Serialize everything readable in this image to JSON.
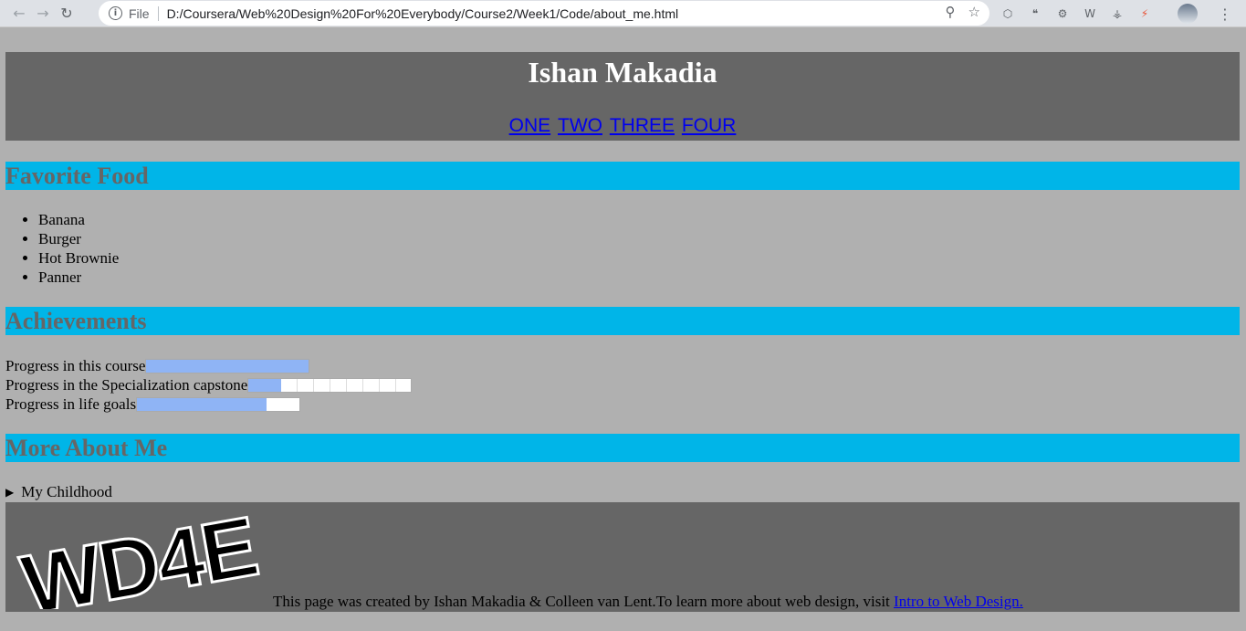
{
  "browser": {
    "url_scheme": "File",
    "url": "D:/Coursera/Web%20Design%20For%20Everybody/Course2/Week1/Code/about_me.html"
  },
  "header": {
    "title": "Ishan Makadia",
    "nav": [
      "ONE",
      "TWO",
      "THREE",
      "FOUR"
    ]
  },
  "sections": {
    "food": "Favorite Food",
    "achievements": "Achievements",
    "more": "More About Me"
  },
  "foods": [
    "Banana",
    "Burger",
    "Hot Brownie",
    "Panner"
  ],
  "progress": [
    {
      "label": "Progress in this course",
      "value": 1.0
    },
    {
      "label": "Progress in the Specialization capstone",
      "value": 0.2
    },
    {
      "label": "Progress in life goals",
      "value": 0.8
    }
  ],
  "details": {
    "summary": "My Childhood"
  },
  "footer": {
    "logo_text": "WD4E",
    "text": "This page was created by Ishan Makadia & Colleen van Lent.To learn more about web design, visit ",
    "link_text": "Intro to Web Design."
  }
}
